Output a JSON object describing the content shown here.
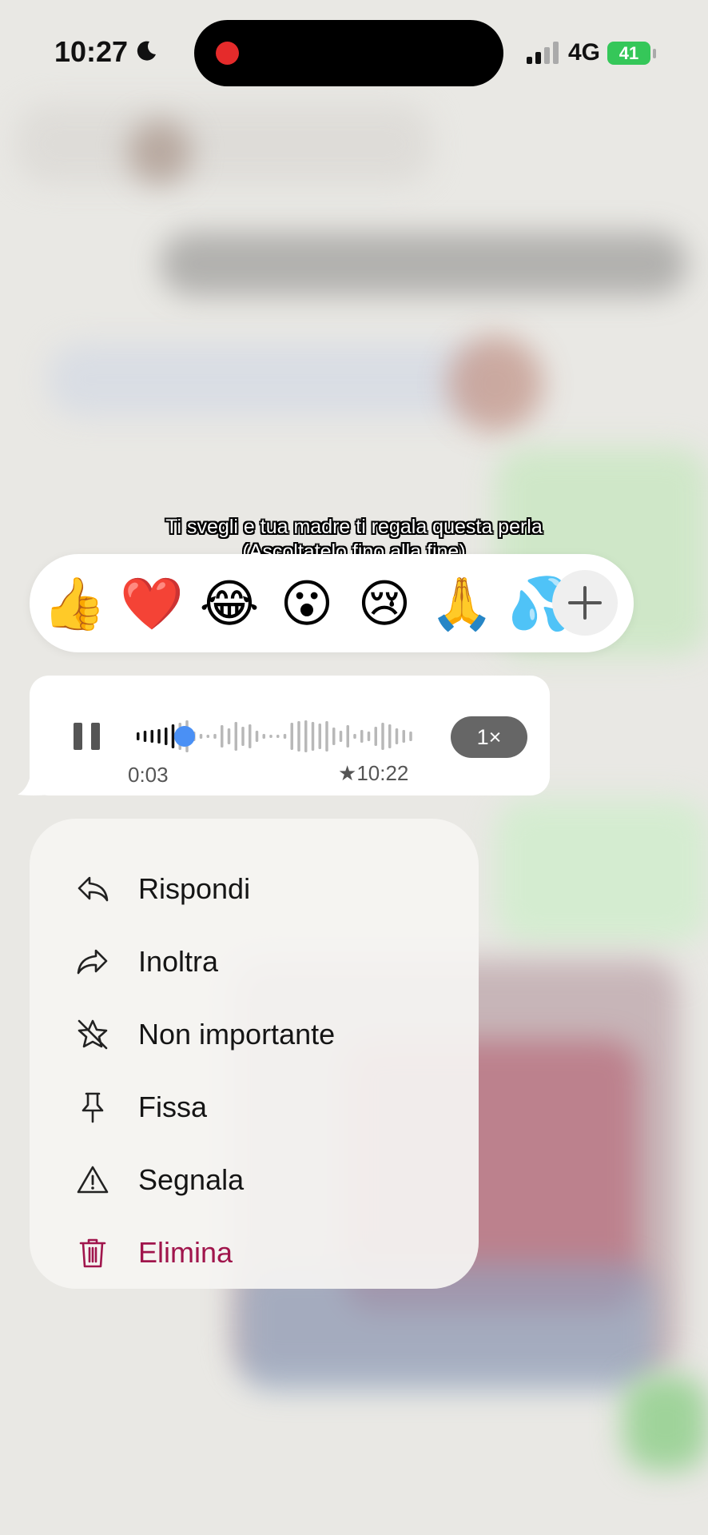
{
  "status_bar": {
    "time": "10:27",
    "network": "4G",
    "battery": "41",
    "moon_icon": "moon-icon",
    "recording_indicator_color": "#e52b2b",
    "battery_color": "#35c759"
  },
  "caption": {
    "line1": "Ti svegli e tua madre ti regala questa perla",
    "line2": "(Ascoltatelo fino alla fine)"
  },
  "reactions": {
    "emojis": [
      "👍",
      "❤️",
      "😂",
      "😮",
      "😢",
      "🙏",
      "💦"
    ],
    "more_icon": "plus-icon"
  },
  "voice_message": {
    "play_state_icon": "pause-icon",
    "elapsed": "0:03",
    "time": "10:22",
    "starred": true,
    "speed": "1×",
    "progress": 0.14,
    "progress_color": "#4a90f5"
  },
  "menu": {
    "items": [
      {
        "label": "Rispondi",
        "icon": "reply-icon"
      },
      {
        "label": "Inoltra",
        "icon": "forward-icon"
      },
      {
        "label": "Non importante",
        "icon": "unstar-icon"
      },
      {
        "label": "Fissa",
        "icon": "pin-icon"
      },
      {
        "label": "Segnala",
        "icon": "report-icon"
      },
      {
        "label": "Elimina",
        "icon": "trash-icon",
        "danger_color": "#a0154c"
      }
    ]
  }
}
